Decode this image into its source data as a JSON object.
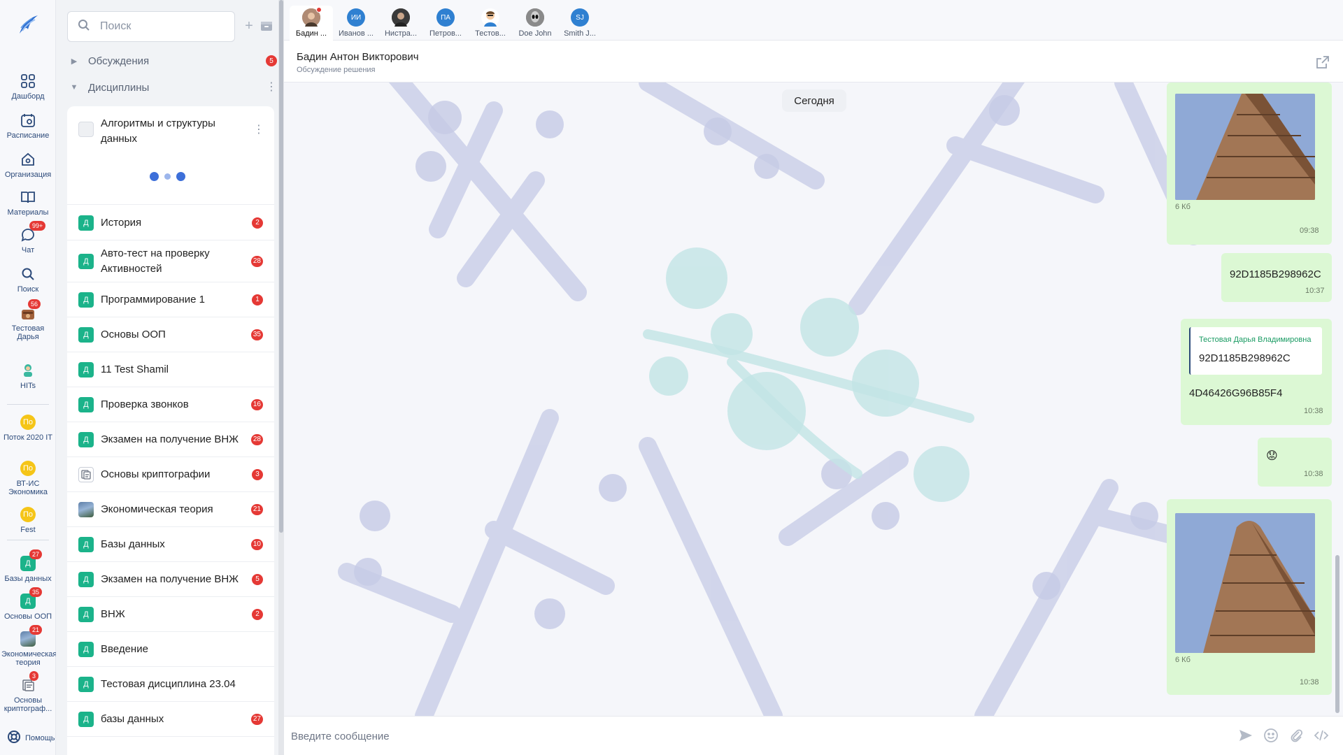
{
  "rail": {
    "items": [
      {
        "label": "Дашборд"
      },
      {
        "label": "Расписание"
      },
      {
        "label": "Организация"
      },
      {
        "label": "Материалы"
      },
      {
        "label": "Чат",
        "badge": "99+"
      },
      {
        "label": "Поиск"
      },
      {
        "label": "Тестовая Дарья",
        "badge": "56"
      },
      {
        "label": "HITs"
      },
      {
        "label": "Поток 2020 IT",
        "icon_text": "По"
      },
      {
        "label": "ВТ-ИС Экономика",
        "icon_text": "По"
      },
      {
        "label": "Fest",
        "icon_text": "По"
      },
      {
        "label": "Базы данных",
        "icon_text": "Д",
        "badge": "27"
      },
      {
        "label": "Основы ООП",
        "icon_text": "Д",
        "badge": "35"
      },
      {
        "label": "Экономическая теория",
        "badge": "21"
      },
      {
        "label": "Основы криптограф...",
        "badge": "3"
      }
    ],
    "help_label": "Помощь"
  },
  "panel": {
    "search_placeholder": "Поиск",
    "group_discussions": {
      "label": "Обсуждения",
      "badge": "5"
    },
    "group_disciplines": {
      "label": "Дисциплины"
    },
    "pinned": {
      "title": "Алгоритмы и структуры данных"
    },
    "rows": [
      {
        "label": "История",
        "icon": "Д",
        "badge": "2"
      },
      {
        "label": "Авто-тест на проверку Активностей",
        "icon": "Д",
        "badge": "28"
      },
      {
        "label": "Программирование 1",
        "icon": "Д",
        "badge": "1"
      },
      {
        "label": "Основы ООП",
        "icon": "Д",
        "badge": "35"
      },
      {
        "label": "11 Test Shamil",
        "icon": "Д",
        "badge": ""
      },
      {
        "label": "Проверка звонков",
        "icon": "Д",
        "badge": "16"
      },
      {
        "label": "Экзамен на получение ВНЖ",
        "icon": "Д",
        "badge": "28"
      },
      {
        "label": "Основы криптографии",
        "icon": "",
        "badge": "3"
      },
      {
        "label": "Экономическая теория",
        "icon": "",
        "badge": "21"
      },
      {
        "label": "Базы данных",
        "icon": "Д",
        "badge": "10"
      },
      {
        "label": "Экзамен на получение ВНЖ",
        "icon": "Д",
        "badge": "5"
      },
      {
        "label": "ВНЖ",
        "icon": "Д",
        "badge": "2"
      },
      {
        "label": "Введение",
        "icon": "Д",
        "badge": ""
      },
      {
        "label": "Тестовая дисциплина 23.04",
        "icon": "Д",
        "badge": ""
      },
      {
        "label": "базы данных",
        "icon": "Д",
        "badge": "27"
      }
    ]
  },
  "tabs": [
    {
      "label": "Бадин ...",
      "initials": "",
      "color": "#8d6e63"
    },
    {
      "label": "Иванов ...",
      "initials": "ИИ",
      "color": "#2f80d1"
    },
    {
      "label": "Нистра...",
      "initials": "",
      "color": "#4a4a4a"
    },
    {
      "label": "Петров...",
      "initials": "ПА",
      "color": "#2f80d1"
    },
    {
      "label": "Тестов...",
      "initials": "",
      "color": "#f0c070"
    },
    {
      "label": "Doe John",
      "initials": "",
      "color": "#6d6d6d"
    },
    {
      "label": "Smith J...",
      "initials": "SJ",
      "color": "#2f80d1"
    }
  ],
  "chat": {
    "title": "Бадин Антон Викторович",
    "subtitle": "Обсуждение решения",
    "date_divider": "Сегодня",
    "messages": [
      {
        "type": "image",
        "size": "6 Кб",
        "time": "09:38"
      },
      {
        "type": "text",
        "text": "92D1185B298962C",
        "time": "10:37"
      },
      {
        "type": "reply",
        "quote_author": "Тестовая Дарья Владимировна",
        "quote_text": "92D1185B298962C",
        "text": "4D46426G96B85F4",
        "time": "10:38"
      },
      {
        "type": "emoji",
        "text": "😟",
        "time": "10:38"
      },
      {
        "type": "image",
        "size": "6 Кб",
        "time": "10:38"
      }
    ],
    "composer_placeholder": "Введите сообщение"
  },
  "colors": {
    "accent": "#2c4a7a",
    "badge": "#e53935",
    "discipline_icon": "#1bb38a",
    "bubble": "#dcf8d4",
    "stream_icon": "#f5c518"
  }
}
